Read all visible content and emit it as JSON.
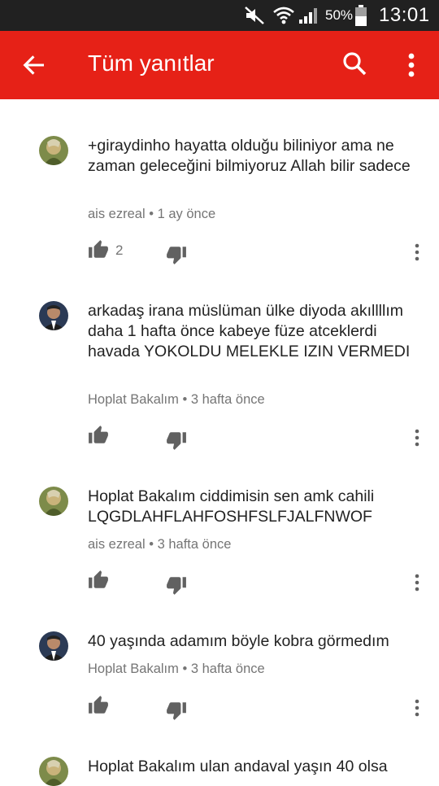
{
  "status_bar": {
    "battery": "50%",
    "time": "13:01",
    "icons": [
      "mute-icon",
      "wifi-icon",
      "signal-icon",
      "battery-icon"
    ]
  },
  "app_bar": {
    "title": "Tüm yanıtlar",
    "background": "#e62117",
    "icons": [
      "back-arrow-icon",
      "search-icon",
      "more-vert-icon"
    ]
  },
  "comments": [
    {
      "text": "+giraydinho hayatta olduğu biliniyor ama ne zaman geleceğini bilmiyoruz Allah bilir sadece",
      "author": "ais ezreal",
      "time": "1 ay önce",
      "likes": "2",
      "avatar": "green-avatar"
    },
    {
      "text": "arkadaş irana müslüman ülke diyoda akıllllım daha 1 hafta önce kabeye füze atceklerdi havada YOKOLDU MELEKLE IZIN VERMEDI",
      "author": "Hoplat Bakalım",
      "time": "3 hafta önce",
      "likes": "",
      "avatar": "dark-avatar"
    },
    {
      "text": "Hoplat Bakalım ciddimisin sen amk cahili LQGDLAHFLAHFOSHFSLFJALFNWOF",
      "author": "ais ezreal",
      "time": "3 hafta önce",
      "likes": "",
      "avatar": "green-avatar"
    },
    {
      "text": "40 yaşında adamım böyle kobra görmedım",
      "author": "Hoplat Bakalım",
      "time": "3 hafta önce",
      "likes": "",
      "avatar": "dark-avatar"
    },
    {
      "text": "Hoplat Bakalım ulan andaval yaşın 40 olsa",
      "author": "",
      "time": "",
      "likes": "",
      "avatar": "green-avatar"
    }
  ],
  "meta_separator": "•"
}
